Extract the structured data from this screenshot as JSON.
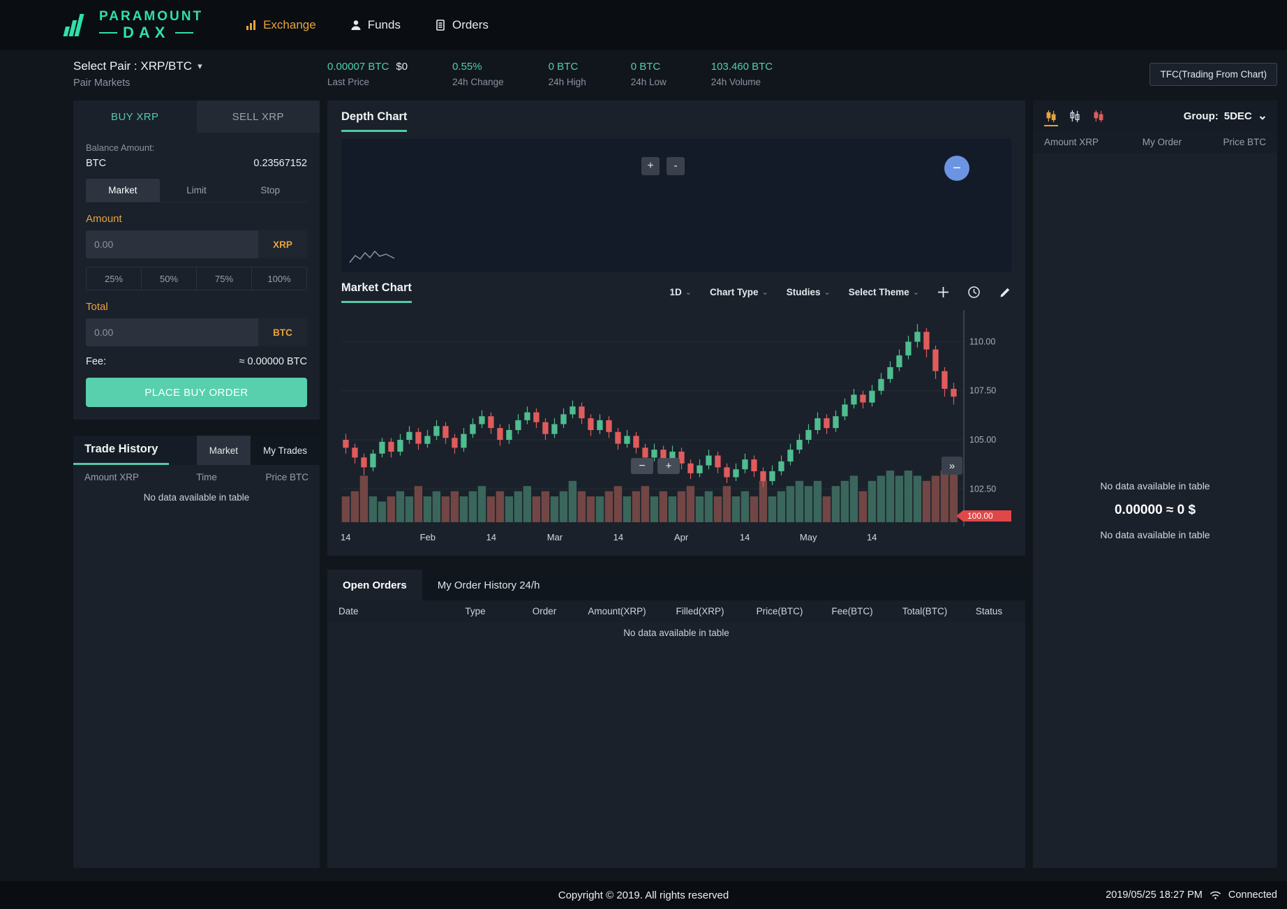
{
  "header": {
    "brand": {
      "top": "PARAMOUNT",
      "bottom": "DAX"
    },
    "nav": [
      {
        "label": "Exchange",
        "active": true
      },
      {
        "label": "Funds",
        "active": false
      },
      {
        "label": "Orders",
        "active": false
      }
    ]
  },
  "icons": {
    "plus": "+",
    "minus": "−",
    "hyphen": "-",
    "double_arrow": "»",
    "chevron": "⌄",
    "caret": "▾"
  },
  "subheader": {
    "select_pair": "Select Pair : XRP/BTC",
    "pair_markets": "Pair Markets",
    "stats": [
      {
        "value": "0.00007 BTC",
        "extra": "$0",
        "label": "Last Price"
      },
      {
        "value": "0.55%",
        "extra": "",
        "label": "24h Change"
      },
      {
        "value": "0 BTC",
        "extra": "",
        "label": "24h High"
      },
      {
        "value": "0 BTC",
        "extra": "",
        "label": "24h Low"
      },
      {
        "value": "103.460 BTC",
        "extra": "",
        "label": "24h Volume"
      }
    ],
    "tfc_button": "TFC(Trading From Chart)"
  },
  "trade_panel": {
    "buy_tab": "BUY XRP",
    "sell_tab": "SELL XRP",
    "balance_label": "Balance Amount:",
    "balance_currency": "BTC",
    "balance_value": "0.23567152",
    "order_tabs": [
      "Market",
      "Limit",
      "Stop"
    ],
    "amount_label": "Amount",
    "amount_placeholder": "0.00",
    "amount_suffix": "XRP",
    "percents": [
      "25%",
      "50%",
      "75%",
      "100%"
    ],
    "total_label": "Total",
    "total_placeholder": "0.00",
    "total_suffix": "BTC",
    "fee_label": "Fee:",
    "fee_value": "≈ 0.00000 BTC",
    "submit_label": "PLACE BUY ORDER"
  },
  "trade_history": {
    "title": "Trade History",
    "tabs": [
      "Market",
      "My Trades"
    ],
    "columns": [
      "Amount XRP",
      "Time",
      "Price BTC"
    ],
    "empty": "No data available in table"
  },
  "depth_chart": {
    "title": "Depth Chart"
  },
  "market_chart": {
    "title": "Market Chart",
    "interval": "1D",
    "chart_type": "Chart Type",
    "studies": "Studies",
    "theme": "Select Theme"
  },
  "chart_data": {
    "type": "candlestick",
    "pair": "XRP/BTC",
    "interval": "1D",
    "ylim": [
      101.8,
      111.4
    ],
    "yticks": [
      110.0,
      107.5,
      105.0,
      102.5
    ],
    "xticks": [
      {
        "label": "14",
        "pos": 0.007
      },
      {
        "label": "Feb",
        "pos": 0.14
      },
      {
        "label": "14",
        "pos": 0.243
      },
      {
        "label": "Mar",
        "pos": 0.346
      },
      {
        "label": "14",
        "pos": 0.449
      },
      {
        "label": "Apr",
        "pos": 0.551
      },
      {
        "label": "14",
        "pos": 0.654
      },
      {
        "label": "May",
        "pos": 0.757
      },
      {
        "label": "14",
        "pos": 0.86
      }
    ],
    "last_price_tag": 100.0,
    "up_color": "#4fbd8f",
    "down_color": "#e05c5c",
    "vol_up": "#3e6e60",
    "vol_down": "#7c4a47",
    "tag_color": "#e04848",
    "candles": [
      [
        105.0,
        105.3,
        104.3,
        104.6,
        0.5
      ],
      [
        104.6,
        104.8,
        103.8,
        104.1,
        0.6
      ],
      [
        104.1,
        104.3,
        103.2,
        103.6,
        0.9
      ],
      [
        103.6,
        104.5,
        103.4,
        104.3,
        0.5
      ],
      [
        104.3,
        105.1,
        104.1,
        104.9,
        0.4
      ],
      [
        104.9,
        105.1,
        104.1,
        104.4,
        0.5
      ],
      [
        104.4,
        105.3,
        104.2,
        105.0,
        0.6
      ],
      [
        105.0,
        105.7,
        104.8,
        105.4,
        0.5
      ],
      [
        105.4,
        105.6,
        104.5,
        104.8,
        0.7
      ],
      [
        104.8,
        105.5,
        104.6,
        105.2,
        0.5
      ],
      [
        105.2,
        106.0,
        105.0,
        105.7,
        0.6
      ],
      [
        105.7,
        105.9,
        104.8,
        105.1,
        0.5
      ],
      [
        105.1,
        105.3,
        104.3,
        104.6,
        0.6
      ],
      [
        104.6,
        105.6,
        104.4,
        105.3,
        0.5
      ],
      [
        105.3,
        106.1,
        105.1,
        105.8,
        0.6
      ],
      [
        105.8,
        106.5,
        105.6,
        106.2,
        0.7
      ],
      [
        106.2,
        106.4,
        105.3,
        105.6,
        0.5
      ],
      [
        105.6,
        105.8,
        104.7,
        105.0,
        0.6
      ],
      [
        105.0,
        105.8,
        104.8,
        105.5,
        0.5
      ],
      [
        105.5,
        106.3,
        105.3,
        106.0,
        0.6
      ],
      [
        106.0,
        106.7,
        105.8,
        106.4,
        0.7
      ],
      [
        106.4,
        106.6,
        105.6,
        105.9,
        0.5
      ],
      [
        105.9,
        106.1,
        105.0,
        105.3,
        0.6
      ],
      [
        105.3,
        106.1,
        105.1,
        105.8,
        0.5
      ],
      [
        105.8,
        106.6,
        105.6,
        106.3,
        0.6
      ],
      [
        106.3,
        107.0,
        106.1,
        106.7,
        0.8
      ],
      [
        106.7,
        106.9,
        105.8,
        106.1,
        0.6
      ],
      [
        106.1,
        106.3,
        105.2,
        105.5,
        0.5
      ],
      [
        105.5,
        106.3,
        105.3,
        106.0,
        0.5
      ],
      [
        106.0,
        106.2,
        105.1,
        105.4,
        0.6
      ],
      [
        105.4,
        105.6,
        104.5,
        104.8,
        0.7
      ],
      [
        104.8,
        105.5,
        104.6,
        105.2,
        0.5
      ],
      [
        105.2,
        105.4,
        104.3,
        104.6,
        0.6
      ],
      [
        104.6,
        104.8,
        103.8,
        104.1,
        0.7
      ],
      [
        104.1,
        104.8,
        103.9,
        104.5,
        0.5
      ],
      [
        104.5,
        104.7,
        103.6,
        103.9,
        0.6
      ],
      [
        103.9,
        104.7,
        103.7,
        104.4,
        0.5
      ],
      [
        104.4,
        104.6,
        103.5,
        103.8,
        0.6
      ],
      [
        103.8,
        104.0,
        103.0,
        103.3,
        0.7
      ],
      [
        103.3,
        104.0,
        103.1,
        103.7,
        0.5
      ],
      [
        103.7,
        104.5,
        103.5,
        104.2,
        0.6
      ],
      [
        104.2,
        104.4,
        103.3,
        103.6,
        0.5
      ],
      [
        103.6,
        103.8,
        102.8,
        103.1,
        0.7
      ],
      [
        103.1,
        103.8,
        102.9,
        103.5,
        0.5
      ],
      [
        103.5,
        104.3,
        103.3,
        104.0,
        0.6
      ],
      [
        104.0,
        104.2,
        103.1,
        103.4,
        0.5
      ],
      [
        103.4,
        103.6,
        102.6,
        102.9,
        0.8
      ],
      [
        102.9,
        103.7,
        102.7,
        103.4,
        0.5
      ],
      [
        103.4,
        104.2,
        103.2,
        103.9,
        0.6
      ],
      [
        103.9,
        104.8,
        103.7,
        104.5,
        0.7
      ],
      [
        104.5,
        105.3,
        104.3,
        105.0,
        0.8
      ],
      [
        105.0,
        105.8,
        104.8,
        105.5,
        0.7
      ],
      [
        105.5,
        106.4,
        105.3,
        106.1,
        0.8
      ],
      [
        106.1,
        106.3,
        105.3,
        105.6,
        0.5
      ],
      [
        105.6,
        106.5,
        105.4,
        106.2,
        0.7
      ],
      [
        106.2,
        107.1,
        106.0,
        106.8,
        0.8
      ],
      [
        106.8,
        107.6,
        106.6,
        107.3,
        0.9
      ],
      [
        107.3,
        107.5,
        106.6,
        106.9,
        0.6
      ],
      [
        106.9,
        107.8,
        106.7,
        107.5,
        0.8
      ],
      [
        107.5,
        108.4,
        107.3,
        108.1,
        0.9
      ],
      [
        108.1,
        109.0,
        107.9,
        108.7,
        1.0
      ],
      [
        108.7,
        109.6,
        108.5,
        109.3,
        0.9
      ],
      [
        109.3,
        110.3,
        109.1,
        110.0,
        1.0
      ],
      [
        110.0,
        110.9,
        109.7,
        110.5,
        0.9
      ],
      [
        110.5,
        110.7,
        109.2,
        109.6,
        0.8
      ],
      [
        109.6,
        109.8,
        108.1,
        108.5,
        0.9
      ],
      [
        108.5,
        108.7,
        107.2,
        107.6,
        1.0
      ],
      [
        107.6,
        107.9,
        106.8,
        107.2,
        1.0
      ]
    ]
  },
  "open_orders": {
    "tabs": [
      "Open Orders",
      "My Order History 24/h"
    ],
    "columns": [
      "Date",
      "Type",
      "Order",
      "Amount(XRP)",
      "Filled(XRP)",
      "Price(BTC)",
      "Fee(BTC)",
      "Total(BTC)",
      "Status"
    ],
    "empty": "No data available in table"
  },
  "order_book": {
    "group_label": "Group:",
    "group_value": "5DEC",
    "columns": [
      "Amount XRP",
      "My Order",
      "Price BTC"
    ],
    "empty_top": "No data available in table",
    "mid_value": "0.00000 ≈ 0 $",
    "empty_bottom": "No data available in table"
  },
  "footer": {
    "copyright": "Copyright © 2019. All rights reserved",
    "datetime": "2019/05/25 18:27 PM",
    "connection": "Connected"
  },
  "colors": {
    "accent_teal": "#53c9a7",
    "accent_orange": "#e8a33d",
    "candle_up": "#4fbd8f",
    "candle_down": "#e05c5c",
    "blue_button": "#6b95e2",
    "price_tag": "#e04848"
  }
}
